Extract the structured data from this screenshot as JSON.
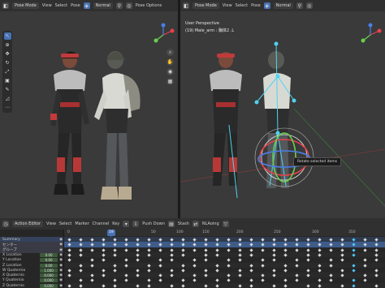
{
  "viewport_left": {
    "header": {
      "mode": "Pose Mode",
      "menus": [
        "View",
        "Select",
        "Pose"
      ],
      "orientation": "Normal",
      "pose_options": "Pose Options"
    }
  },
  "viewport_right": {
    "header": {
      "mode": "Pose Mode",
      "menus": [
        "View",
        "Select",
        "Pose"
      ],
      "orientation": "Normal"
    },
    "overlay": {
      "view_name": "User Perspective",
      "object_line": "(19) Male_arm : 胸体2 .L"
    },
    "tooltip": "Rotate selected items"
  },
  "action_editor": {
    "header": {
      "editor": "Action Editor",
      "menus": [
        "View",
        "Select",
        "Marker",
        "Channel",
        "Key"
      ],
      "push_down": "Push Down",
      "stash": "Stash",
      "nla_label": "NLAoing"
    },
    "frames": [
      "0",
      "19",
      "50",
      "100",
      "150",
      "200",
      "250",
      "300",
      "350"
    ],
    "current_frame": "19",
    "channels": [
      {
        "label": "Summary",
        "value": ""
      },
      {
        "label": "センター",
        "value": ""
      },
      {
        "label": "グループ",
        "value": ""
      },
      {
        "label": "X Location",
        "value": "0.00"
      },
      {
        "label": "Y Location",
        "value": "0.00"
      },
      {
        "label": "Z Location",
        "value": "0.00"
      },
      {
        "label": "W Quaternio",
        "value": "1.000"
      },
      {
        "label": "X Quaternio",
        "value": "0.000"
      },
      {
        "label": "Y Quaternio",
        "value": "0.000"
      },
      {
        "label": "Z Quaternio",
        "value": "0.000"
      }
    ]
  },
  "colors": {
    "accent": "#4772b3",
    "viewport_bg": "#3a3a3a",
    "header_bg": "#303030",
    "bone_cyan": "#4fd2f0",
    "gizmo_red": "#e8404a",
    "gizmo_green": "#6ad04c",
    "gizmo_blue": "#4a7fe8"
  }
}
